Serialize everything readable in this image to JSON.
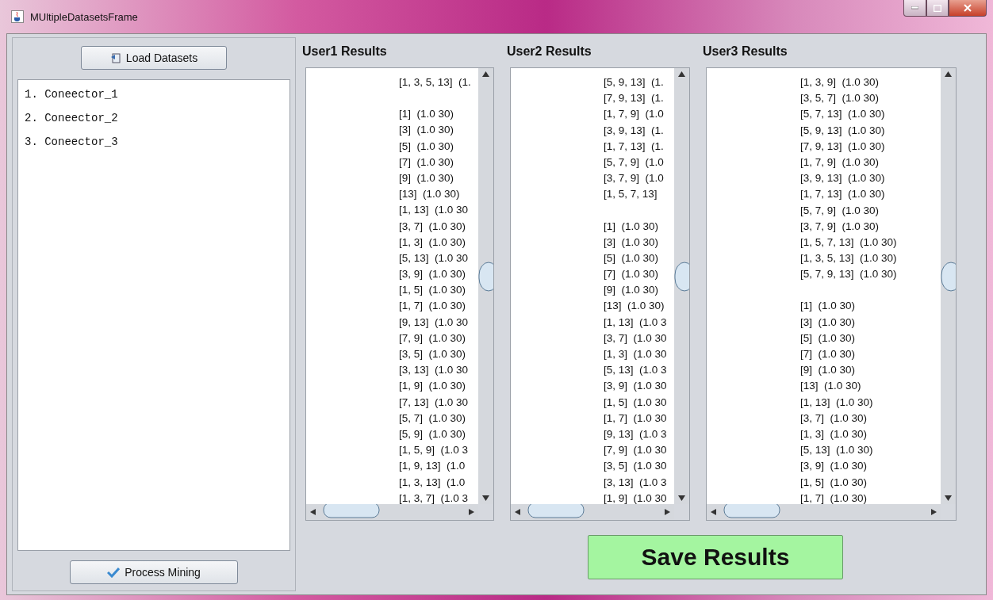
{
  "window": {
    "title": "MUltipleDatasetsFrame"
  },
  "left_panel": {
    "load_button": "Load Datasets",
    "datasets": [
      {
        "number": "1.",
        "name": "Coneector_1"
      },
      {
        "number": "2.",
        "name": "Coneector_2"
      },
      {
        "number": "3.",
        "name": "Coneector_3"
      }
    ],
    "process_button": "Process Mining"
  },
  "results": [
    {
      "title": "User1 Results",
      "groups": [
        [
          "[1, 3, 5, 13]  (1."
        ],
        [
          "[1]  (1.0 30)",
          "[3]  (1.0 30)",
          "[5]  (1.0 30)",
          "[7]  (1.0 30)",
          "[9]  (1.0 30)",
          "[13]  (1.0 30)",
          "[1, 13]  (1.0 30",
          "[3, 7]  (1.0 30)",
          "[1, 3]  (1.0 30)",
          "[5, 13]  (1.0 30",
          "[3, 9]  (1.0 30)",
          "[1, 5]  (1.0 30)",
          "[1, 7]  (1.0 30)",
          "[9, 13]  (1.0 30",
          "[7, 9]  (1.0 30)",
          "[3, 5]  (1.0 30)",
          "[3, 13]  (1.0 30",
          "[1, 9]  (1.0 30)",
          "[7, 13]  (1.0 30",
          "[5, 7]  (1.0 30)",
          "[5, 9]  (1.0 30)",
          "[1, 5, 9]  (1.0 3",
          "[1, 9, 13]  (1.0",
          "[1, 3, 13]  (1.0",
          "[1, 3, 7]  (1.0 3"
        ]
      ]
    },
    {
      "title": "User2 Results",
      "groups": [
        [
          "[5, 9, 13]  (1.",
          "[7, 9, 13]  (1.",
          "[1, 7, 9]  (1.0",
          "[3, 9, 13]  (1.",
          "[1, 7, 13]  (1.",
          "[5, 7, 9]  (1.0",
          "[3, 7, 9]  (1.0",
          "[1, 5, 7, 13]"
        ],
        [
          "[1]  (1.0 30)",
          "[3]  (1.0 30)",
          "[5]  (1.0 30)",
          "[7]  (1.0 30)",
          "[9]  (1.0 30)",
          "[13]  (1.0 30)",
          "[1, 13]  (1.0 3",
          "[3, 7]  (1.0 30",
          "[1, 3]  (1.0 30",
          "[5, 13]  (1.0 3",
          "[3, 9]  (1.0 30",
          "[1, 5]  (1.0 30",
          "[1, 7]  (1.0 30",
          "[9, 13]  (1.0 3",
          "[7, 9]  (1.0 30",
          "[3, 5]  (1.0 30",
          "[3, 13]  (1.0 3",
          "[1, 9]  (1.0 30"
        ]
      ]
    },
    {
      "title": "User3 Results",
      "groups": [
        [
          "[1, 3, 9]  (1.0 30)",
          "[3, 5, 7]  (1.0 30)",
          "[5, 7, 13]  (1.0 30)",
          "[5, 9, 13]  (1.0 30)",
          "[7, 9, 13]  (1.0 30)",
          "[1, 7, 9]  (1.0 30)",
          "[3, 9, 13]  (1.0 30)",
          "[1, 7, 13]  (1.0 30)",
          "[5, 7, 9]  (1.0 30)",
          "[3, 7, 9]  (1.0 30)",
          "[1, 5, 7, 13]  (1.0 30)",
          "[1, 3, 5, 13]  (1.0 30)",
          "[5, 7, 9, 13]  (1.0 30)"
        ],
        [
          "[1]  (1.0 30)",
          "[3]  (1.0 30)",
          "[5]  (1.0 30)",
          "[7]  (1.0 30)",
          "[9]  (1.0 30)",
          "[13]  (1.0 30)",
          "[1, 13]  (1.0 30)",
          "[3, 7]  (1.0 30)",
          "[1, 3]  (1.0 30)",
          "[5, 13]  (1.0 30)",
          "[3, 9]  (1.0 30)",
          "[1, 5]  (1.0 30)",
          "[1, 7]  (1.0 30)"
        ]
      ]
    }
  ],
  "save_button": "Save Results"
}
